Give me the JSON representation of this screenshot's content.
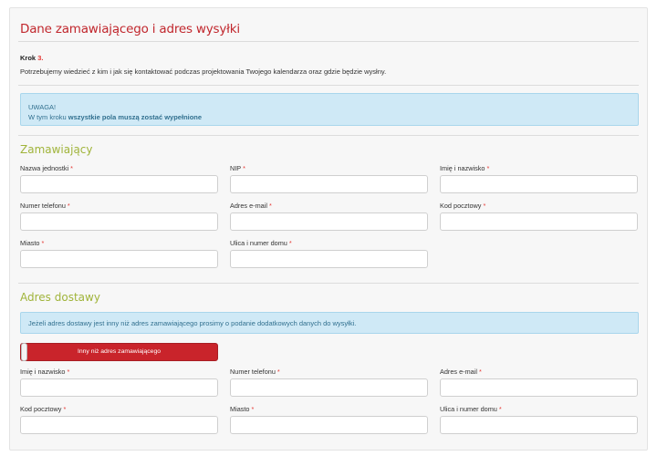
{
  "header": {
    "title": "Dane zamawiającego i adres wysyłki"
  },
  "step": {
    "label": "Krok",
    "number": "3.",
    "description": "Potrzebujemy wiedzieć z kim i jak się kontaktować podczas projektowania Twojego kalendarza oraz gdzie będzie wysłny."
  },
  "notice": {
    "heading": "UWAGA!",
    "text_prefix": "W tym kroku ",
    "text_bold": "wszystkie pola muszą zostać wypełnione"
  },
  "orderer": {
    "title": "Zamawiający",
    "fields": [
      {
        "label": "Nazwa jednostki",
        "required": "*",
        "value": ""
      },
      {
        "label": "NIP",
        "required": "*",
        "value": ""
      },
      {
        "label": "Imię i nazwisko",
        "required": "*",
        "value": ""
      },
      {
        "label": "Numer telefonu",
        "required": "*",
        "value": ""
      },
      {
        "label": "Adres e-mail",
        "required": "*",
        "value": ""
      },
      {
        "label": "Kod pocztowy",
        "required": "*",
        "value": ""
      },
      {
        "label": "Miasto",
        "required": "*",
        "value": ""
      },
      {
        "label": "Ulica i numer domu",
        "required": "*",
        "value": ""
      }
    ]
  },
  "delivery": {
    "title": "Adres dostawy",
    "info": "Jeżeli adres dostawy jest inny niż adres zamawiającego prosimy o podanie dodatkowych danych do wysyłki.",
    "toggle_label": "Inny niż adres zamawiającego",
    "fields": [
      {
        "label": "Imię i nazwisko",
        "required": "*",
        "value": ""
      },
      {
        "label": "Numer telefonu",
        "required": "*",
        "value": ""
      },
      {
        "label": "Adres e-mail",
        "required": "*",
        "value": ""
      },
      {
        "label": "Kod pocztowy",
        "required": "*",
        "value": ""
      },
      {
        "label": "Miasto",
        "required": "*",
        "value": ""
      },
      {
        "label": "Ulica i numer domu",
        "required": "*",
        "value": ""
      }
    ]
  },
  "colors": {
    "title_red": "#c1272d",
    "section_green": "#a0b43a",
    "required_red": "#e53935",
    "info_blue_bg": "#cfe9f6",
    "toggle_red": "#c9242b"
  }
}
